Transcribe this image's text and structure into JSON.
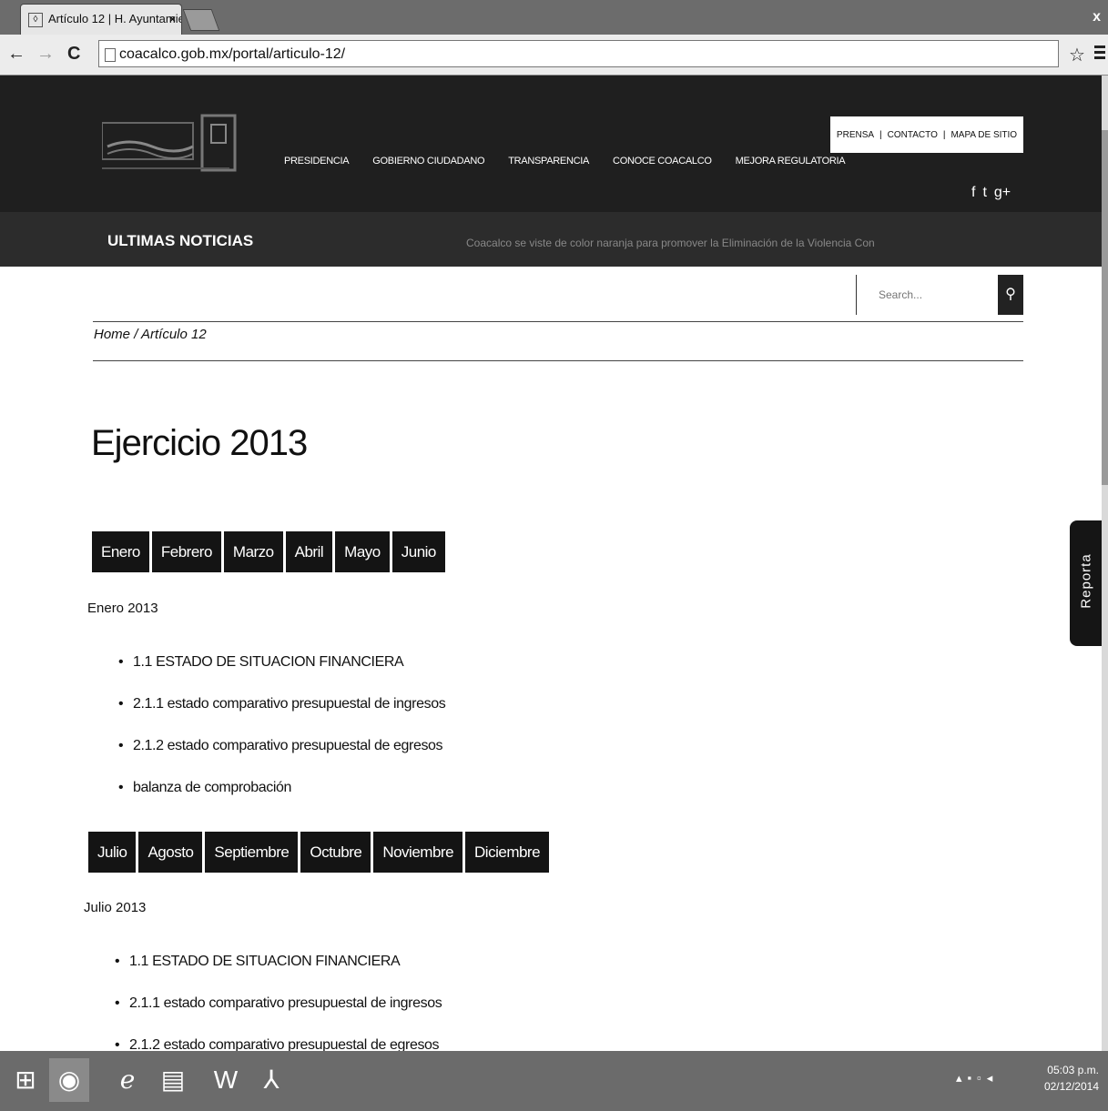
{
  "browser": {
    "tab_title": "Artículo 12 | H. Ayuntamie",
    "tab_close": "×",
    "url": "coacalco.gob.mx/portal/articulo-12/",
    "window_close": "x"
  },
  "header": {
    "main_nav": [
      "PRESIDENCIA",
      "GOBIERNO CIUDADANO",
      "TRANSPARENCIA",
      "CONOCE COACALCO",
      "MEJORA REGULATORIA"
    ],
    "top_nav": [
      "PRENSA",
      "CONTACTO",
      "MAPA DE SITIO"
    ],
    "social": [
      "f",
      "t",
      "g+"
    ],
    "news_label": "ULTIMAS NOTICIAS",
    "news_ticker": "Coacalco se viste de color naranja para promover la Eliminación de la Violencia Con"
  },
  "search": {
    "placeholder": "Search..."
  },
  "breadcrumb": {
    "home": "Home",
    "separator": "/",
    "current": "Artículo 12"
  },
  "page_title": "Ejercicio 2013",
  "sections": [
    {
      "tabs": [
        "Enero",
        "Febrero",
        "Marzo",
        "Abril",
        "Mayo",
        "Junio"
      ],
      "label": "Enero 2013",
      "items": [
        "1.1 ESTADO DE SITUACION FINANCIERA",
        "2.1.1 estado comparativo presupuestal de ingresos",
        "2.1.2 estado comparativo presupuestal de egresos",
        "balanza de comprobación"
      ]
    },
    {
      "tabs": [
        "Julio",
        "Agosto",
        "Septiembre",
        "Octubre",
        "Noviembre",
        "Diciembre"
      ],
      "label": "Julio 2013",
      "items": [
        "1.1 ESTADO DE SITUACION FINANCIERA",
        "2.1.1 estado comparativo presupuestal de ingresos",
        "2.1.2 estado comparativo presupuestal de egresos"
      ]
    }
  ],
  "reporta": "Reporta",
  "taskbar": {
    "time": "05:03 p.m.",
    "date": "02/12/2014"
  }
}
